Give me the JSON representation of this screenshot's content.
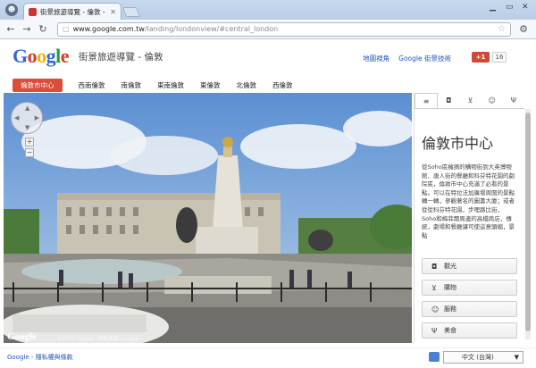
{
  "browser": {
    "tab_title": "街景旅遊導覽 - 倫敦 - Go",
    "url_host": "www.google.com.tw",
    "url_path": "/landing/londonview/#central_london"
  },
  "header": {
    "logo_letters": [
      "G",
      "o",
      "o",
      "g",
      "l",
      "e"
    ],
    "site_title": "街景旅遊導覽 - 倫敦",
    "links": [
      "地圖視角",
      "Google 街景技術"
    ],
    "plusone_label": "+1",
    "plusone_count": "16"
  },
  "nav": {
    "items": [
      "倫敦市中心",
      "西南倫敦",
      "南倫敦",
      "東南倫敦",
      "東倫敦",
      "北倫敦",
      "西倫敦"
    ],
    "active_index": 0
  },
  "streetview": {
    "watermark": "Google",
    "copyright": "©2012 Google · 資料來源: Google"
  },
  "panel": {
    "title": "倫敦市中心",
    "description": "從Soho區擁擠的購物街到大英博物館、唐人街的餐廳和科芬特花園的劇院區，倫敦市中心充滿了必看的景點。可以在特拉法加廣場周圍的景點轉一轉，參觀著名的圖書大廈；或者從從科芬特花園，步哩路比街，Soho和梅菲爾周邊的高檔商店，傳統，劇場和餐廳讓可使這意頭縮，景點",
    "buttons": [
      {
        "label": "觀光",
        "icon": "camera-icon"
      },
      {
        "label": "購物",
        "icon": "cart-icon"
      },
      {
        "label": "服務",
        "icon": "person-icon"
      },
      {
        "label": "美食",
        "icon": "fork-icon"
      }
    ]
  },
  "footer": {
    "links": "Google - 隱私權與條款",
    "language": "中文 (台灣)"
  },
  "colors": {
    "accent": "#dd4b39",
    "link": "#2255bb"
  }
}
